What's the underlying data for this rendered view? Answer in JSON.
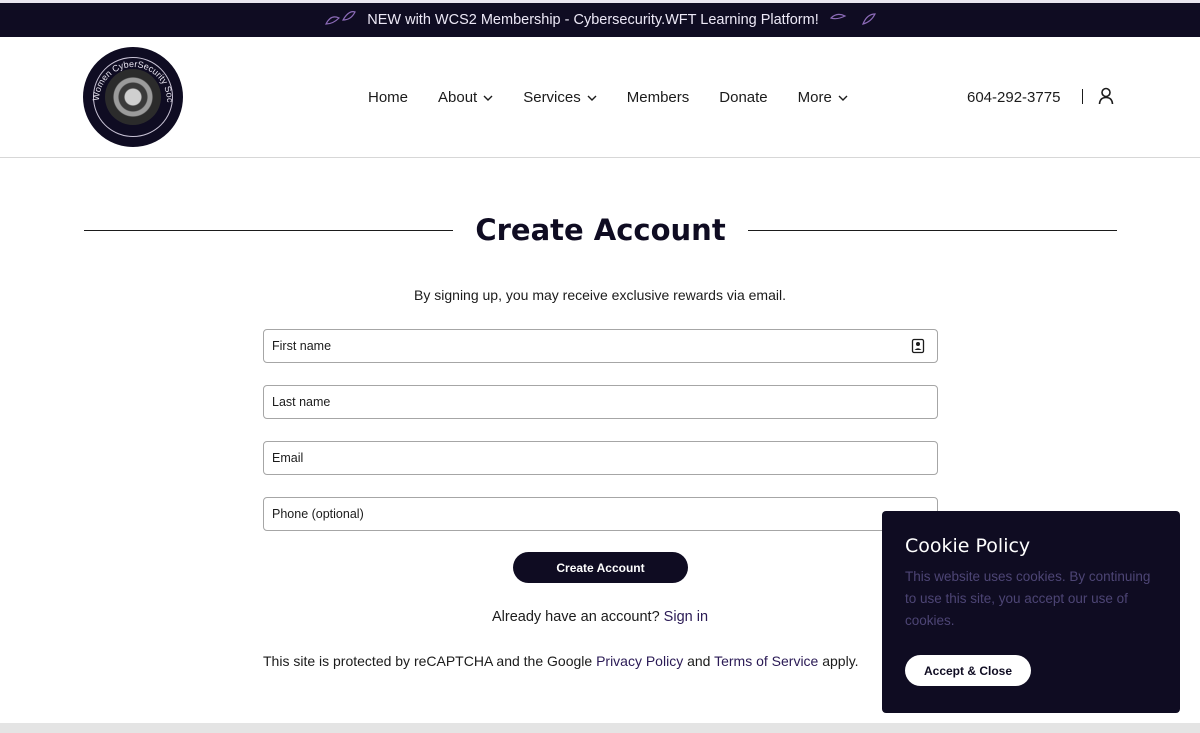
{
  "banner": {
    "text": "NEW with WCS2 Membership - Cybersecurity.WFT Learning Platform!",
    "decor_icon": "leaf-icon"
  },
  "header": {
    "logo_text": "Women CyberSecurity Society",
    "nav": [
      {
        "label": "Home",
        "has_dropdown": false
      },
      {
        "label": "About",
        "has_dropdown": true
      },
      {
        "label": "Services",
        "has_dropdown": true
      },
      {
        "label": "Members",
        "has_dropdown": false
      },
      {
        "label": "Donate",
        "has_dropdown": false
      },
      {
        "label": "More",
        "has_dropdown": true
      }
    ],
    "phone": "604-292-3775",
    "account_icon": "user-icon"
  },
  "main": {
    "title": "Create Account",
    "subtitle": "By signing up, you may receive exclusive rewards via email.",
    "fields": [
      {
        "label": "First name",
        "value": ""
      },
      {
        "label": "Last name",
        "value": ""
      },
      {
        "label": "Email",
        "value": ""
      },
      {
        "label": "Phone (optional)",
        "value": ""
      }
    ],
    "submit_label": "Create Account",
    "signin_prompt": "Already have an account?",
    "signin_link": "Sign in",
    "recaptcha": {
      "prefix": "This site is protected by reCAPTCHA and the Google",
      "privacy": "Privacy Policy",
      "and": "and",
      "terms": "Terms of Service",
      "suffix": "apply."
    }
  },
  "cookie": {
    "title": "Cookie Policy",
    "text": "This website uses cookies. By continuing to use this site, you accept our use of cookies.",
    "button": "Accept & Close"
  },
  "colors": {
    "brand_dark": "#0f0c22",
    "link": "#2a1a55",
    "cookie_text": "#4d4575"
  }
}
